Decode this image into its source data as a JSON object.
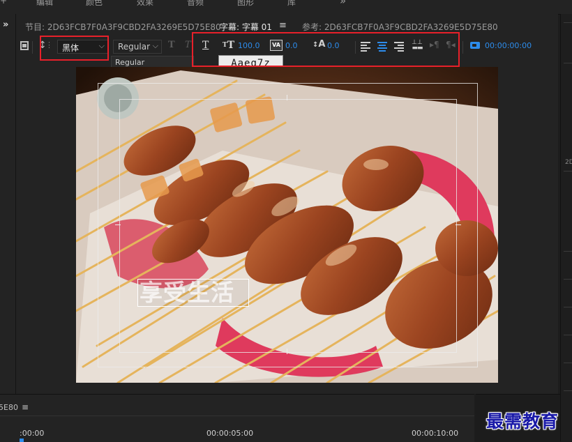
{
  "menu": {
    "items": [
      "编辑",
      "颜色",
      "效果",
      "音频",
      "图形",
      "库"
    ],
    "overflow": "»"
  },
  "header": {
    "expand": "»",
    "program_label": "节目: 2D63FCB7F0A3F9CBD2FA3269E5D75E80",
    "caption_label": "字幕: 字幕 01",
    "menu_icon": "≡",
    "source_label": "参考: 2D63FCB7F0A3F9CBD2FA3269E5D75E80"
  },
  "toolbar": {
    "font_family": "黑体",
    "font_style": "Regular",
    "font_style_option": "Regular",
    "font_size": "100.0",
    "tracking": "0.0",
    "baseline": "0.0",
    "timecode": "00:00:00:00",
    "font_preview": "Aaeg7z",
    "bold_icon": "T",
    "italic_icon": "T",
    "underline_icon": "T"
  },
  "caption": {
    "text": "享受生活"
  },
  "timeline": {
    "id_suffix": "5E80",
    "menu_icon": "≡",
    "ticks": [
      ":00:00",
      "00:00:05:00",
      "00:00:10:00"
    ]
  },
  "watermark": {
    "text": "最需教育"
  },
  "colors": {
    "accent": "#2d8ceb",
    "highlight": "#e8202a",
    "panel": "#232323",
    "watermark": "#1a1aa8"
  }
}
